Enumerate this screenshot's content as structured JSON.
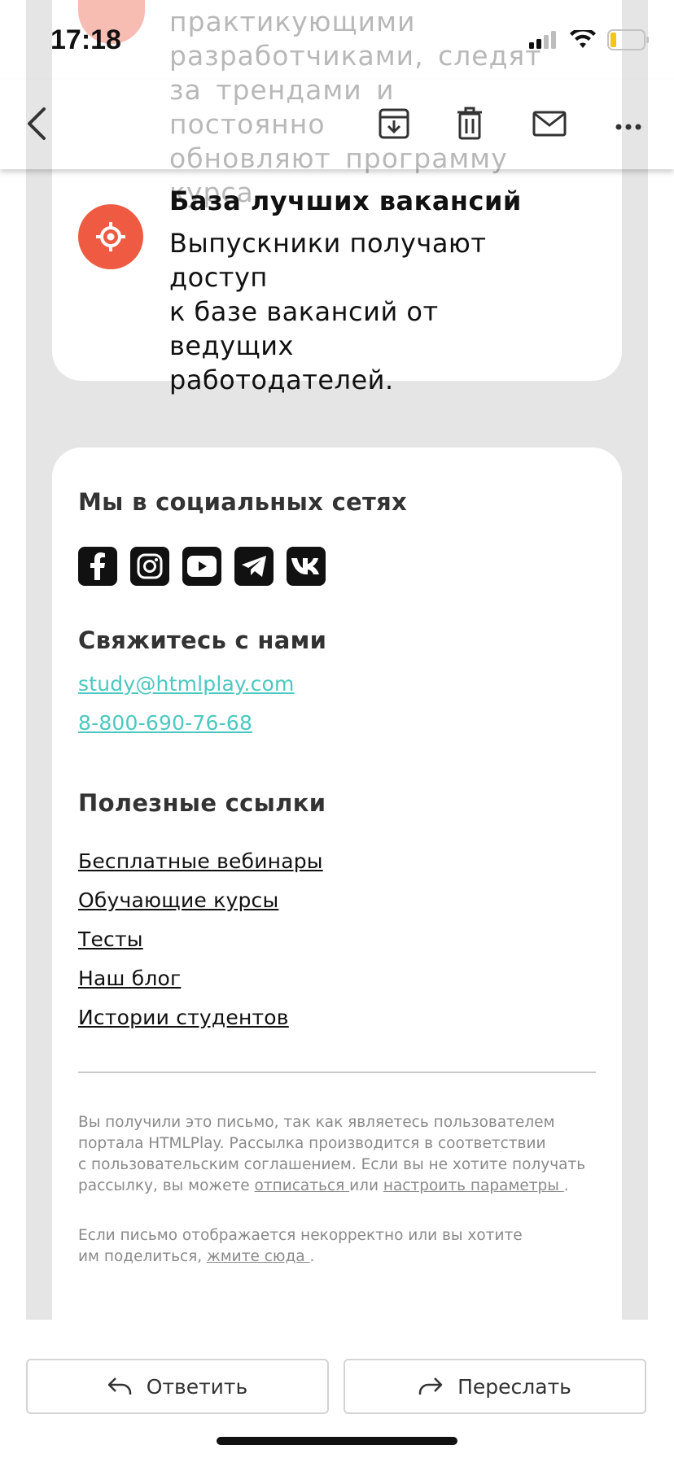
{
  "status_bar": {
    "time": "17:18"
  },
  "background_item": {
    "text_lines": [
      "практикующими",
      "разработчиками, следят",
      "за трендами и постоянно",
      "обновляют программу курса."
    ]
  },
  "feature": {
    "icon": "target-icon",
    "title": "База лучших вакансий",
    "description_lines": [
      "Выпускники получают доступ",
      "к базе вакансий от ведущих",
      "работодателей."
    ]
  },
  "social": {
    "heading": "Мы в социальных сетях",
    "networks": [
      "facebook",
      "instagram",
      "youtube",
      "telegram",
      "vk"
    ]
  },
  "contacts": {
    "heading": "Свяжитесь с нами",
    "email": "study@htmlplay.com",
    "phone": "8-800-690-76-68"
  },
  "useful_links": {
    "heading": "Полезные ссылки",
    "items": [
      "Бесплатные вебинары",
      "Обучающие курсы",
      "Тесты",
      "Наш блог",
      "Истории студентов"
    ]
  },
  "footer": {
    "note1_lines": [
      "Вы получили это письмо, так как являетесь пользователем",
      "портала HTMLPlay. Рассылка производится в соответствии",
      "с пользовательским соглашением. Если вы не хотите получать"
    ],
    "note1_last_prefix": "рассылку, вы можете ",
    "unsubscribe": "отписаться ",
    "or_text": "или ",
    "settings": "настроить параметры ",
    "note1_end": ".",
    "note2_line1": "Если письмо отображается некорректно или вы хотите",
    "note2_prefix": "им поделиться, ",
    "click_here": "жмите сюда ",
    "note2_end": "."
  },
  "actions": {
    "reply": "Ответить",
    "forward": "Переслать"
  },
  "colors": {
    "accent": "#ee5a42",
    "link": "#4cc8c0",
    "background": "#e5e5e5"
  }
}
